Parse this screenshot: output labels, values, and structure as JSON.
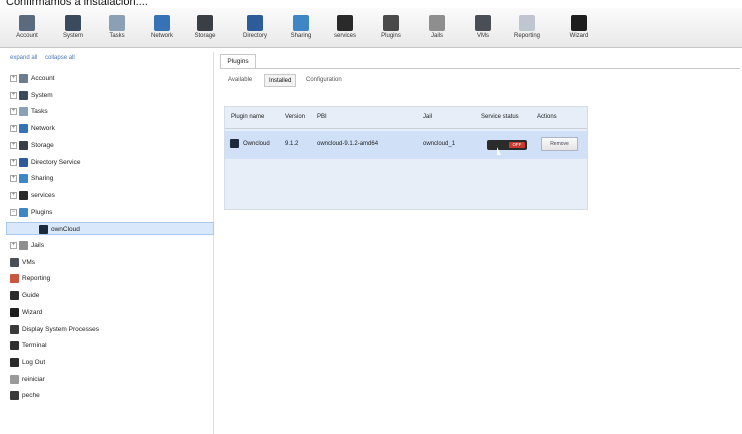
{
  "caption": "Confirmamos a instalación....",
  "toolbar": {
    "items": [
      {
        "label": "Account",
        "icon": "account-icon",
        "color": "#5a6b7d"
      },
      {
        "label": "System",
        "icon": "system-icon",
        "color": "#3a4b5e"
      },
      {
        "label": "Tasks",
        "icon": "tasks-icon",
        "color": "#8aa0b5"
      },
      {
        "label": "Network",
        "icon": "network-icon",
        "color": "#3573b5"
      },
      {
        "label": "Storage",
        "icon": "storage-icon",
        "color": "#3a3f46"
      },
      {
        "label": "Directory",
        "icon": "directory-icon",
        "color": "#2d5c9a"
      },
      {
        "label": "Sharing",
        "icon": "sharing-icon",
        "color": "#3f86c7"
      },
      {
        "label": "services",
        "icon": "services-icon",
        "color": "#2a2a2a"
      },
      {
        "label": "Plugins",
        "icon": "plugins-icon",
        "color": "#4a4a4a"
      },
      {
        "label": "Jails",
        "icon": "jails-icon",
        "color": "#8e8e8e"
      },
      {
        "label": "VMs",
        "icon": "vms-icon",
        "color": "#4a4f56"
      },
      {
        "label": "Reporting",
        "icon": "reporting-icon",
        "color": "#bfc6cf"
      },
      {
        "label": "Wizard",
        "icon": "wizard-icon",
        "color": "#1e1e1e"
      }
    ]
  },
  "tree": {
    "expand_all": "expand all",
    "collapse_all": "collapse all",
    "items": [
      {
        "label": "Account",
        "icon": "account-icon",
        "expander": "+",
        "indent": 0,
        "color": "#6b7c8e"
      },
      {
        "label": "System",
        "icon": "system-icon",
        "expander": "+",
        "indent": 0,
        "color": "#3a4b5e"
      },
      {
        "label": "Tasks",
        "icon": "tasks-icon",
        "expander": "+",
        "indent": 0,
        "color": "#8aa0b5"
      },
      {
        "label": "Network",
        "icon": "network-icon",
        "expander": "+",
        "indent": 0,
        "color": "#3573b5"
      },
      {
        "label": "Storage",
        "icon": "storage-icon",
        "expander": "+",
        "indent": 0,
        "color": "#3a3f46"
      },
      {
        "label": "Directory Service",
        "icon": "directory-icon",
        "expander": "+",
        "indent": 0,
        "color": "#2d5c9a"
      },
      {
        "label": "Sharing",
        "icon": "sharing-icon",
        "expander": "+",
        "indent": 0,
        "color": "#3f86c7"
      },
      {
        "label": "services",
        "icon": "services-icon",
        "expander": "+",
        "indent": 0,
        "color": "#2a2a2a"
      },
      {
        "label": "Plugins",
        "icon": "plugins-icon",
        "expander": "−",
        "indent": 0,
        "color": "#3f86c7"
      },
      {
        "label": "ownCloud",
        "icon": "owncloud-icon",
        "expander": "",
        "indent": 1,
        "color": "#1b2a3c",
        "selected": true
      },
      {
        "label": "Jails",
        "icon": "jails-icon",
        "expander": "+",
        "indent": 0,
        "color": "#8e8e8e"
      },
      {
        "label": "VMs",
        "icon": "vms-icon",
        "expander": "",
        "indent": 0,
        "color": "#4a4f56"
      },
      {
        "label": "Reporting",
        "icon": "reporting-icon",
        "expander": "",
        "indent": 0,
        "color": "#c9563f"
      },
      {
        "label": "Guide",
        "icon": "guide-icon",
        "expander": "",
        "indent": 0,
        "color": "#2a2a2a"
      },
      {
        "label": "Wizard",
        "icon": "wizard-icon",
        "expander": "",
        "indent": 0,
        "color": "#1e1e1e"
      },
      {
        "label": "Display System Processes",
        "icon": "processes-icon",
        "expander": "",
        "indent": 0,
        "color": "#3a3a3a"
      },
      {
        "label": "Terminal",
        "icon": "terminal-icon",
        "expander": "",
        "indent": 0,
        "color": "#2f2f2f"
      },
      {
        "label": "Log Out",
        "icon": "logout-icon",
        "expander": "",
        "indent": 0,
        "color": "#2a2a2a"
      },
      {
        "label": "reiniciar",
        "icon": "restart-icon",
        "expander": "",
        "indent": 0,
        "color": "#9a9a9a"
      },
      {
        "label": "peche",
        "icon": "shutdown-icon",
        "expander": "",
        "indent": 0,
        "color": "#3a3a3a"
      }
    ]
  },
  "main": {
    "tab": "Plugins",
    "subtabs": [
      "Available",
      "Installed",
      "Configuration"
    ],
    "active_subtab": "Installed",
    "columns": [
      "Plugin name",
      "Version",
      "PBI",
      "Jail",
      "Service status",
      "Actions"
    ],
    "rows": [
      {
        "name": "Owncloud",
        "version": "9.1.2",
        "pbi": "owncloud-9.1.2-amd64",
        "jail": "owncloud_1",
        "status": "OFF",
        "action": "Remove"
      }
    ]
  }
}
